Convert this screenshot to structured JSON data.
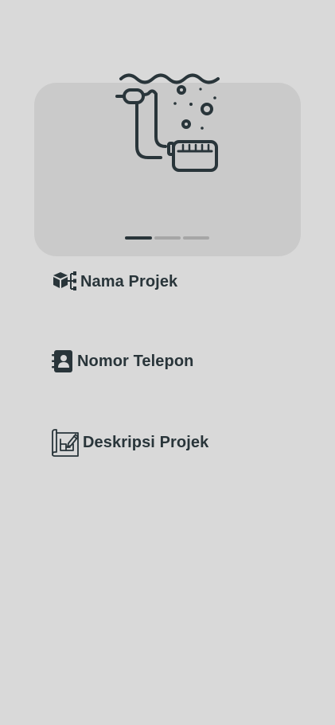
{
  "carousel": {
    "illustration": "scuba-regulator-underwater",
    "slides": 3,
    "active_slide": 1
  },
  "fields": [
    {
      "icon": "box-network-icon",
      "label": "Nama Projek"
    },
    {
      "icon": "contact-book-icon",
      "label": "Nomor Telepon"
    },
    {
      "icon": "blueprint-pencil-icon",
      "label": "Deskripsi Projek"
    }
  ],
  "colors": {
    "background": "#d9d9d9",
    "card": "#cacaca",
    "ink": "#29353a",
    "inactive_dot": "#a6a6a6"
  }
}
